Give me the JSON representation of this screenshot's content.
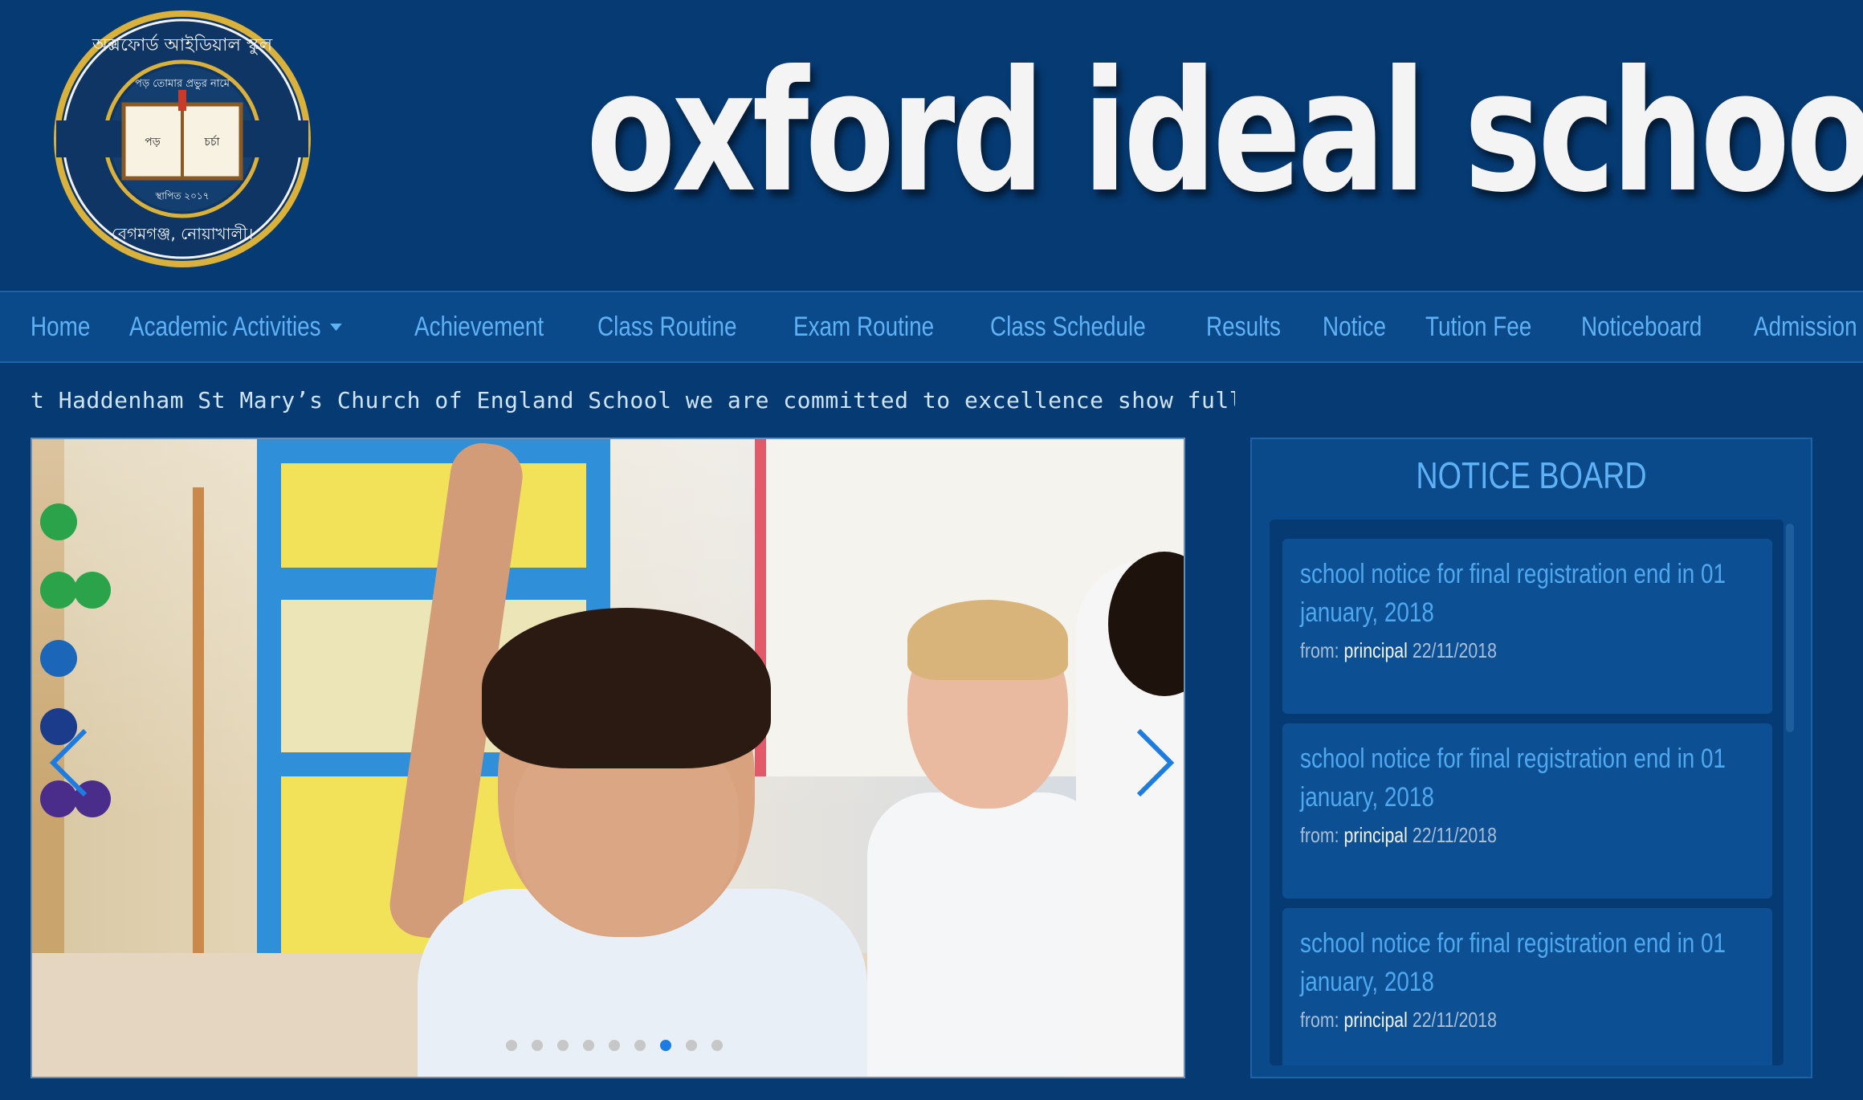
{
  "header": {
    "logo": {
      "name_bn": "অক্সফোর্ড আইডিয়াল স্কুল",
      "motto_bn": "পড় তোমার প্রভুর নামে",
      "book_left": "পড়",
      "book_right": "চর্চা",
      "established_bn": "স্থাপিত ২০১৭",
      "location_bn": "বেগমগঞ্জ, নোয়াখালী।"
    },
    "site_title": "oxford ideal school"
  },
  "nav": {
    "items": [
      {
        "label": "Home",
        "dropdown": false
      },
      {
        "label": "Academic Activities",
        "dropdown": true
      },
      {
        "label": "Achievement",
        "dropdown": false
      },
      {
        "label": "Class Routine",
        "dropdown": false
      },
      {
        "label": "Exam Routine",
        "dropdown": false
      },
      {
        "label": "Class Schedule",
        "dropdown": false
      },
      {
        "label": "Results",
        "dropdown": false
      },
      {
        "label": "Notice",
        "dropdown": false
      },
      {
        "label": "Tution Fee",
        "dropdown": false
      },
      {
        "label": "Noticeboard",
        "dropdown": false
      },
      {
        "label": "Admission",
        "dropdown": true
      }
    ]
  },
  "marquee": {
    "text": "t Haddenham St Mary’s Church of England School we are committed to excellence show full event"
  },
  "slider": {
    "dot_count": 9,
    "active_dot": 6,
    "prev_icon": "chevron-left-icon",
    "next_icon": "chevron-right-icon"
  },
  "notice_board": {
    "title": "NOTICE BOARD",
    "items": [
      {
        "title": "school notice for final registration end in 01 january, 2018",
        "from_label": "from:",
        "from": "principal",
        "date": "22/11/2018"
      },
      {
        "title": "school notice for final registration end in 01 january, 2018",
        "from_label": "from:",
        "from": "principal",
        "date": "22/11/2018"
      },
      {
        "title": "school notice for final registration end in 01 january, 2018",
        "from_label": "from:",
        "from": "principal",
        "date": "22/11/2018"
      }
    ]
  },
  "colors": {
    "background": "#053a72",
    "nav_bg": "#0a4a8a",
    "nav_text": "#5fb1f5",
    "title_text": "#f4f4f4",
    "active_dot": "#1e7ce0",
    "logo_gold": "#d9b13b"
  }
}
